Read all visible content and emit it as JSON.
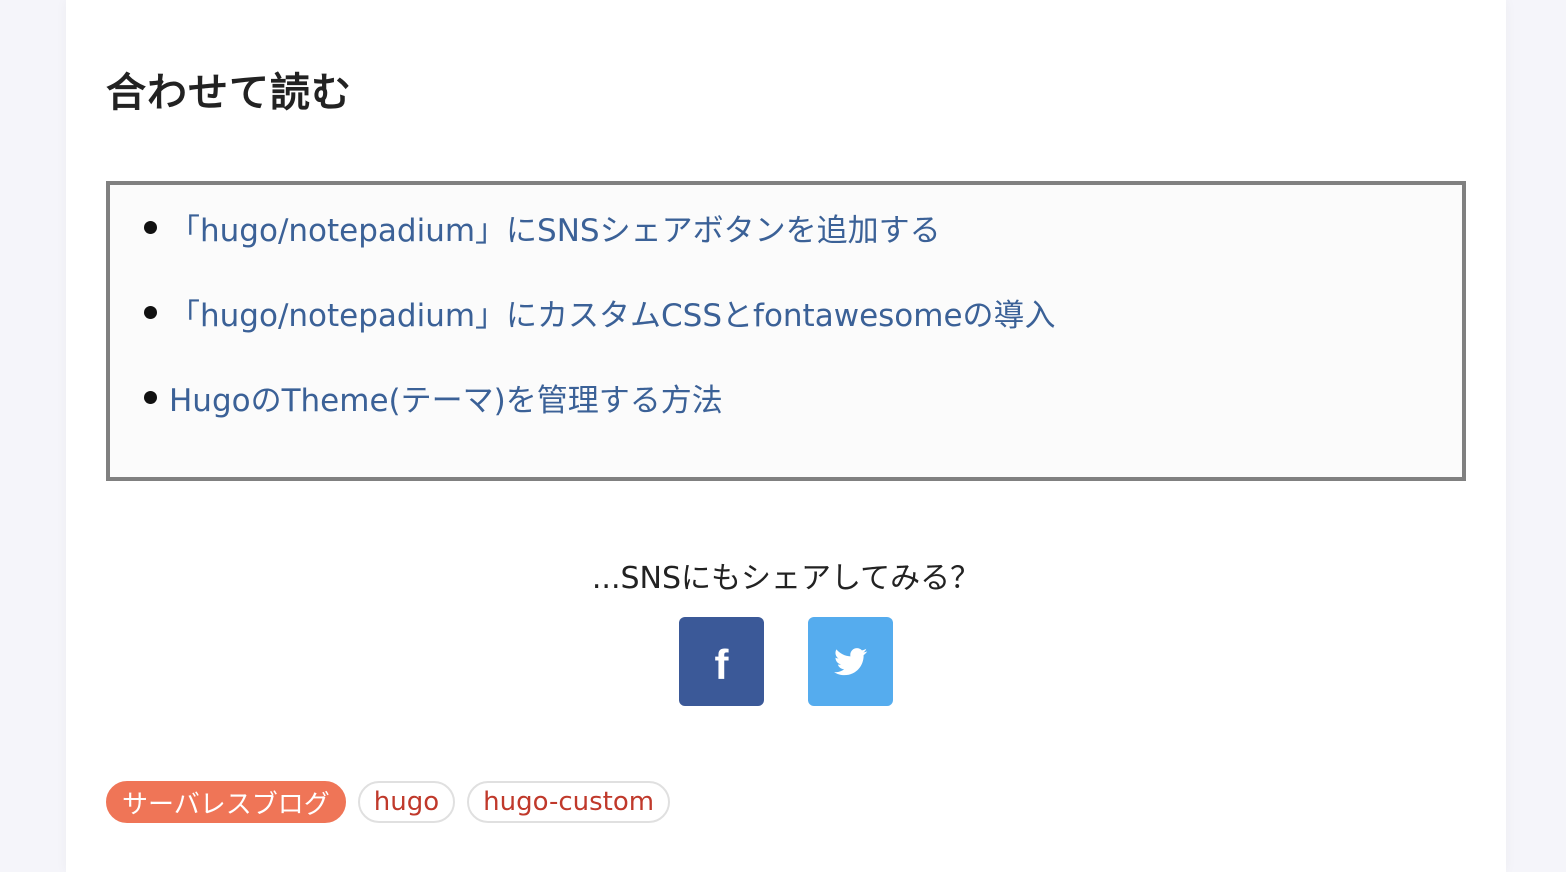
{
  "related": {
    "heading": "合わせて読む",
    "items": [
      {
        "label": "「hugo/notepadium」にSNSシェアボタンを追加する"
      },
      {
        "label": "「hugo/notepadium」にカスタムCSSとfontawesomeの導入"
      },
      {
        "label": "HugoのTheme(テーマ)を管理する方法"
      }
    ]
  },
  "share": {
    "prompt": "...SNSにもシェアしてみる？",
    "buttons": [
      {
        "name": "facebook",
        "icon": "facebook-icon",
        "color": "#3b5998"
      },
      {
        "name": "twitter",
        "icon": "twitter-icon",
        "color": "#55acee"
      }
    ]
  },
  "tags": [
    {
      "label": "サーバレスブログ",
      "kind": "category",
      "color": "#ef7557"
    },
    {
      "label": "hugo",
      "kind": "tag"
    },
    {
      "label": "hugo-custom",
      "kind": "tag"
    }
  ],
  "colors": {
    "link": "#3b6197",
    "tag_text": "#c0392b",
    "box_border": "#808080"
  }
}
